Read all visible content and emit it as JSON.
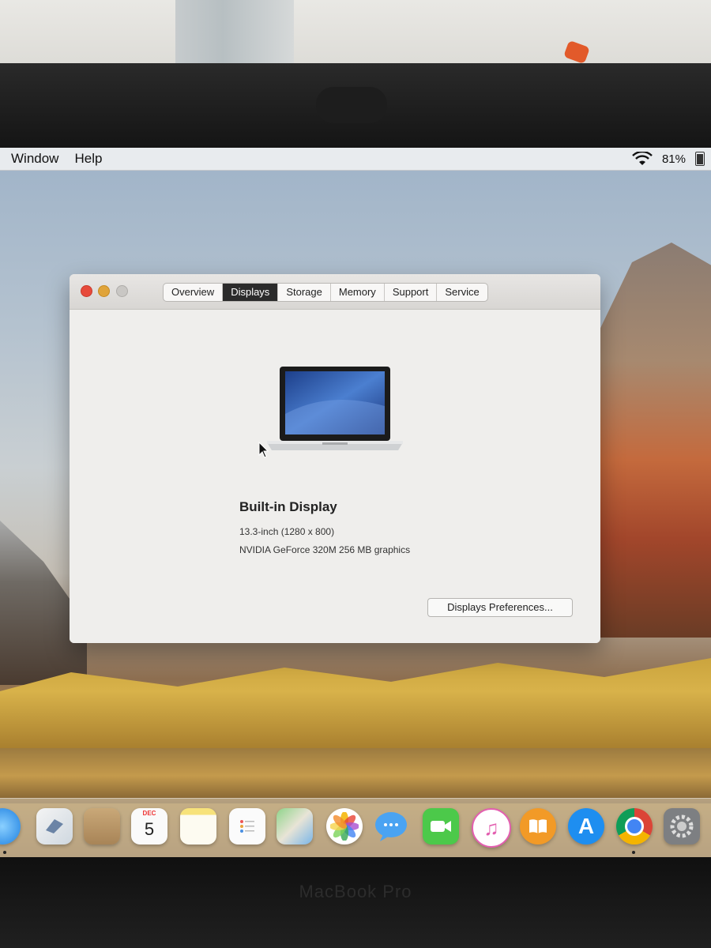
{
  "menubar": {
    "items": [
      "Window",
      "Help"
    ],
    "battery_percent": "81%"
  },
  "window": {
    "tabs": [
      {
        "label": "Overview",
        "active": false
      },
      {
        "label": "Displays",
        "active": true
      },
      {
        "label": "Storage",
        "active": false
      },
      {
        "label": "Memory",
        "active": false
      },
      {
        "label": "Support",
        "active": false
      },
      {
        "label": "Service",
        "active": false
      }
    ],
    "display": {
      "title": "Built-in Display",
      "size": "13.3-inch (1280 x 800)",
      "graphics": "NVIDIA GeForce 320M 256 MB graphics"
    },
    "preferences_button": "Displays Preferences..."
  },
  "dock": {
    "calendar": {
      "month": "DEC",
      "day": "5"
    },
    "icons": [
      "safari-icon",
      "mail-icon",
      "contacts-icon",
      "calendar-icon",
      "notes-icon",
      "reminders-icon",
      "maps-icon",
      "photos-icon",
      "messages-icon",
      "facetime-icon",
      "itunes-icon",
      "ibooks-icon",
      "app-store-icon",
      "chrome-icon",
      "system-preferences-icon"
    ]
  },
  "bezel": {
    "brand": "MacBook Pro"
  },
  "colors": {
    "close": "#e74a3b",
    "minimize": "#e0a43a",
    "active_tab": "#2b2b2b"
  }
}
